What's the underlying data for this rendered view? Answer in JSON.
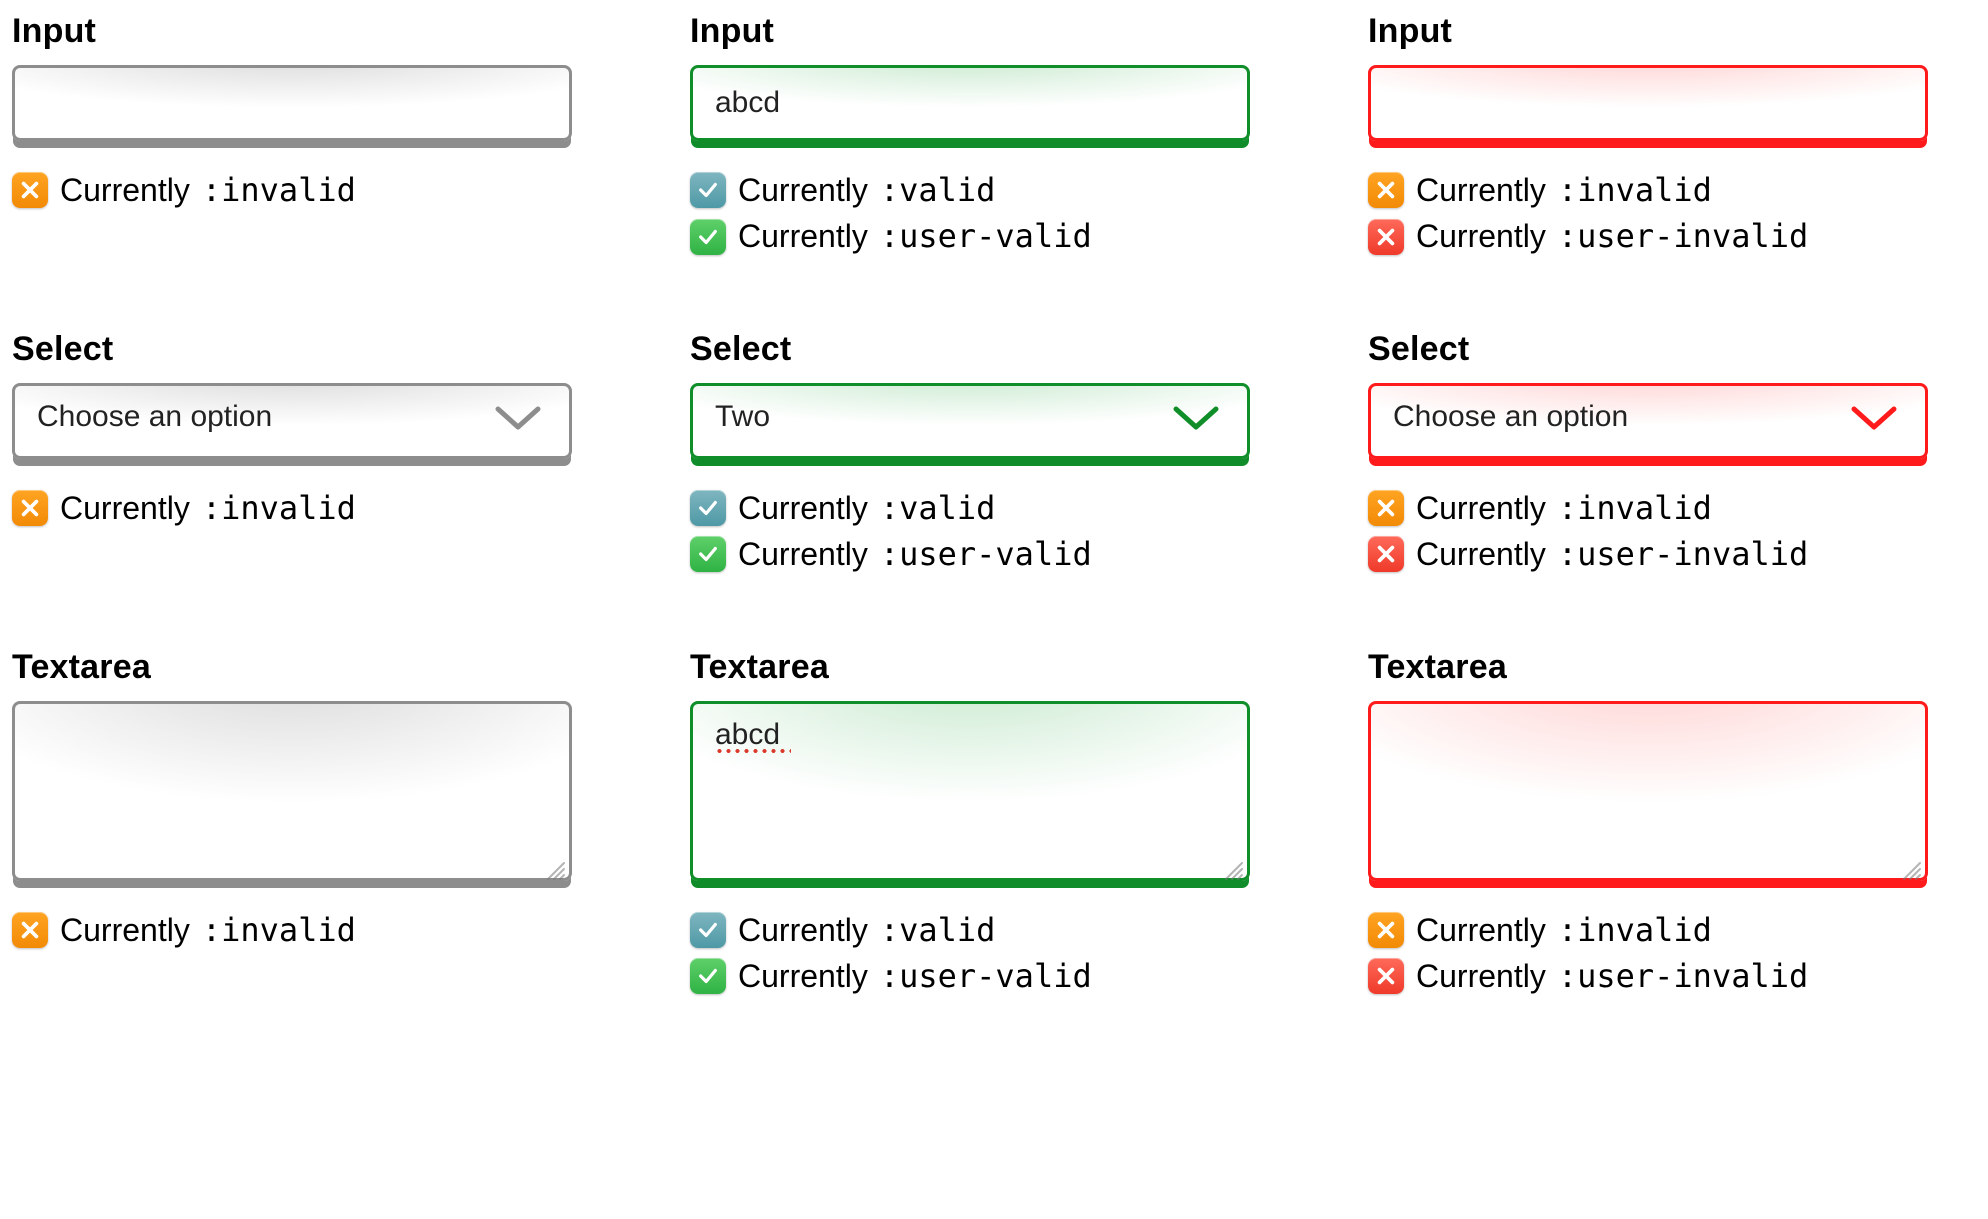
{
  "labels": {
    "input": "Input",
    "select": "Select",
    "textarea": "Textarea",
    "currently": "Currently"
  },
  "pseudo": {
    "invalid": ":invalid",
    "valid": ":valid",
    "user_valid": ":user-valid",
    "user_invalid": ":user-invalid"
  },
  "values": {
    "input_col2": "abcd",
    "select_col1": "Choose an option",
    "select_col2": "Two",
    "select_col3": "Choose an option",
    "textarea_col2": "abcd"
  },
  "icons": {
    "orange_x": "cross-icon",
    "teal_check": "check-icon",
    "green_check": "check-icon",
    "red_x": "cross-icon"
  },
  "colors": {
    "gray": "#8d8d8d",
    "green": "#108e2a",
    "red": "#ff1b1b"
  }
}
